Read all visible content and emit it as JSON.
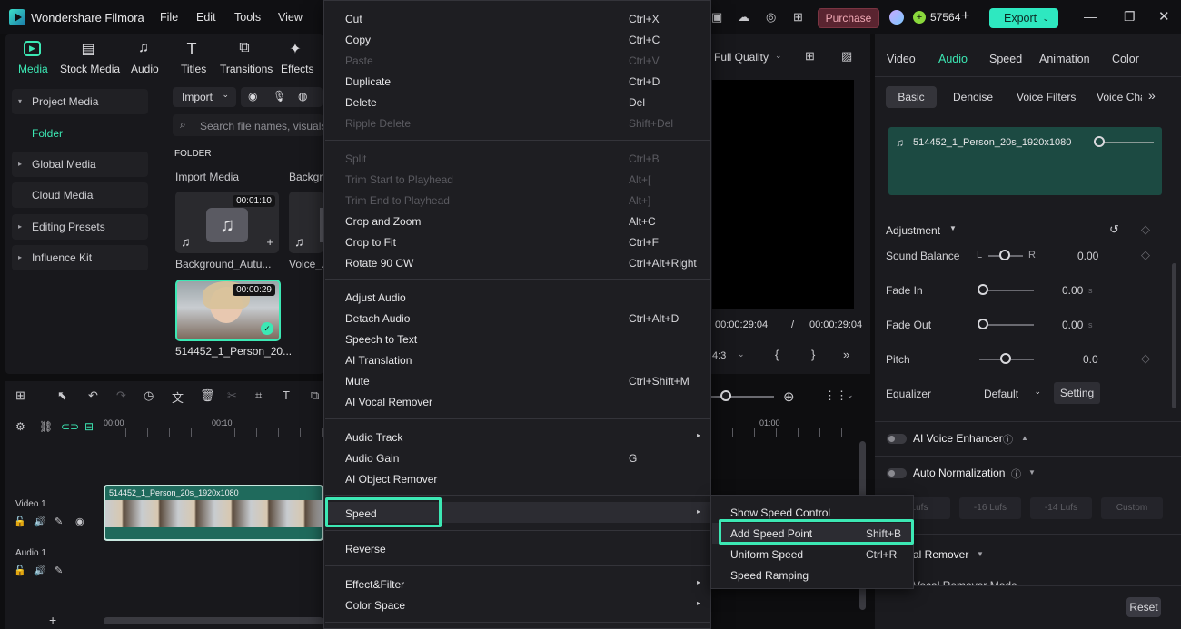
{
  "app": {
    "title": "Wondershare Filmora",
    "menu": [
      "File",
      "Edit",
      "Tools",
      "View"
    ],
    "purchase_label": "Purchase",
    "credits": "57564",
    "export_label": "Export"
  },
  "media_tabs": [
    "Media",
    "Stock Media",
    "Audio",
    "Titles",
    "Transitions",
    "Effects"
  ],
  "sidebar": {
    "items": [
      {
        "label": "Project Media",
        "arrow": "▾"
      },
      {
        "label": "Folder"
      },
      {
        "label": "Global Media",
        "arrow": "▸"
      },
      {
        "label": "Cloud Media"
      },
      {
        "label": "Editing Presets",
        "arrow": "▸"
      },
      {
        "label": "Influence Kit",
        "arrow": "▸"
      }
    ]
  },
  "library": {
    "import_label": "Import",
    "search_placeholder": "Search file names, visuals, a",
    "folder_header": "FOLDER",
    "import_media_label": "Import Media",
    "background_label": "Backgro",
    "items": [
      {
        "name": "Background_Autu...",
        "duration": "00:01:10"
      },
      {
        "name": "Voice_A"
      },
      {
        "name": "514452_1_Person_20...",
        "duration": "00:00:29"
      }
    ]
  },
  "preview": {
    "quality": "Full Quality",
    "current_time": "00:00:29:04",
    "sep": "/",
    "total_time": "00:00:29:04",
    "ratio": "4:3"
  },
  "timeline": {
    "ruler": [
      "00:00",
      "00:10",
      "01:00"
    ],
    "tracks": [
      {
        "label": "Video 1",
        "clip": "514452_1_Person_20s_1920x1080"
      },
      {
        "label": "Audio 1"
      }
    ]
  },
  "context_menu": {
    "items": [
      {
        "label": "Cut",
        "shortcut": "Ctrl+X"
      },
      {
        "label": "Copy",
        "shortcut": "Ctrl+C"
      },
      {
        "label": "Paste",
        "shortcut": "Ctrl+V",
        "disabled": true
      },
      {
        "label": "Duplicate",
        "shortcut": "Ctrl+D"
      },
      {
        "label": "Delete",
        "shortcut": "Del"
      },
      {
        "label": "Ripple Delete",
        "shortcut": "Shift+Del",
        "disabled": true
      },
      {
        "label": "Split",
        "shortcut": "Ctrl+B",
        "disabled": true
      },
      {
        "label": "Trim Start to Playhead",
        "shortcut": "Alt+[",
        "disabled": true
      },
      {
        "label": "Trim End to Playhead",
        "shortcut": "Alt+]",
        "disabled": true
      },
      {
        "label": "Crop and Zoom",
        "shortcut": "Alt+C"
      },
      {
        "label": "Crop to Fit",
        "shortcut": "Ctrl+F"
      },
      {
        "label": "Rotate 90 CW",
        "shortcut": "Ctrl+Alt+Right"
      },
      {
        "label": "Adjust Audio",
        "shortcut": ""
      },
      {
        "label": "Detach Audio",
        "shortcut": "Ctrl+Alt+D"
      },
      {
        "label": "Speech to Text",
        "shortcut": ""
      },
      {
        "label": "AI Translation",
        "shortcut": ""
      },
      {
        "label": "Mute",
        "shortcut": "Ctrl+Shift+M"
      },
      {
        "label": "AI Vocal Remover",
        "shortcut": ""
      },
      {
        "label": "Audio Track",
        "shortcut": "",
        "submenu": true
      },
      {
        "label": "Audio Gain",
        "shortcut": "G"
      },
      {
        "label": "AI Object Remover",
        "shortcut": ""
      },
      {
        "label": "Speed",
        "shortcut": "",
        "submenu": true,
        "highlight": true
      },
      {
        "label": "Reverse",
        "shortcut": ""
      },
      {
        "label": "Effect&Filter",
        "shortcut": "",
        "submenu": true
      },
      {
        "label": "Color Space",
        "shortcut": "",
        "submenu": true
      }
    ]
  },
  "speed_submenu": {
    "items": [
      {
        "label": "Show Speed Control",
        "shortcut": ""
      },
      {
        "label": "Add Speed Point",
        "shortcut": "Shift+B",
        "highlight": true
      },
      {
        "label": "Uniform Speed",
        "shortcut": "Ctrl+R"
      },
      {
        "label": "Speed Ramping",
        "shortcut": ""
      }
    ]
  },
  "inspector": {
    "tabs": [
      "Video",
      "Audio",
      "Speed",
      "Animation",
      "Color"
    ],
    "active_tab": "Audio",
    "subtabs": [
      "Basic",
      "Denoise",
      "Voice Filters",
      "Voice Cha"
    ],
    "clip_name": "514452_1_Person_20s_1920x1080",
    "adjustment_label": "Adjustment",
    "sound_balance": {
      "label": "Sound Balance",
      "left": "L",
      "right": "R",
      "value": "0.00"
    },
    "fade_in": {
      "label": "Fade In",
      "value": "0.00",
      "unit": "s"
    },
    "fade_out": {
      "label": "Fade Out",
      "value": "0.00",
      "unit": "s"
    },
    "pitch": {
      "label": "Pitch",
      "value": "0.0"
    },
    "equalizer": {
      "label": "Equalizer",
      "value": "Default",
      "setting_label": "Setting"
    },
    "ai_voice_enhancer": "AI Voice Enhancer",
    "auto_normalization": "Auto Normalization",
    "lufs_options": [
      "Lufs",
      "-16 Lufs",
      "-14 Lufs",
      "Custom"
    ],
    "vocal_remover": "al Remover",
    "vocal_remover_mode": "Vocal Remover Mode",
    "reset_label": "Reset"
  },
  "colors": {
    "accent": "#3ce8b4",
    "export": "#2ee8c0",
    "purchase_bg": "#5a2430"
  }
}
